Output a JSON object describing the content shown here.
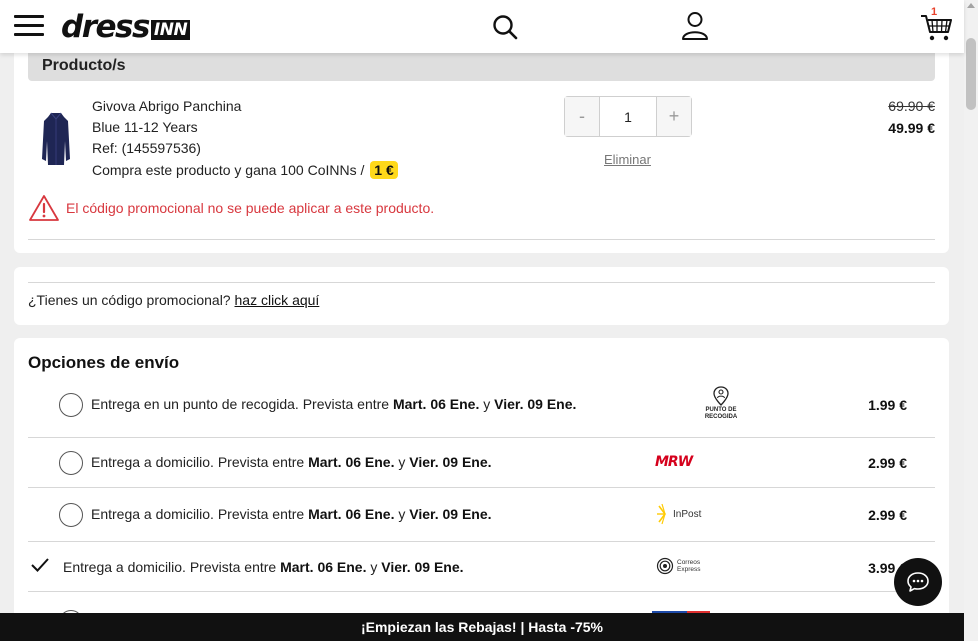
{
  "header": {
    "logo_main": "dress",
    "logo_badge": "INN",
    "cart_count": "1"
  },
  "products_section": {
    "title": "Producto/s",
    "item": {
      "name": "Givova Abrigo Panchina",
      "variant": "Blue 11-12 Years",
      "ref": "Ref: (145597536)",
      "coins_text": "Compra este producto y gana 100 CoINNs /",
      "coins_badge": "1 €",
      "quantity": "1",
      "qty_minus": "-",
      "qty_plus": "+",
      "remove_label": "Eliminar",
      "price_old": "69.90 €",
      "price_new": "49.99 €"
    },
    "promo_error": "El código promocional no se puede aplicar a este producto."
  },
  "promo": {
    "question": "¿Tienes un código promocional?",
    "link": "haz click aquí"
  },
  "shipping": {
    "title": "Opciones de envío",
    "options": [
      {
        "label": "Entrega en un punto de recogida. Prevista entre",
        "date_from": "Mart. 06 Ene.",
        "connector": "y",
        "date_to": "Vier. 09 Ene.",
        "carrier_line1": "PUNTO DE",
        "carrier_line2": "RECOGIDA",
        "price": "1.99 €",
        "selected": false
      },
      {
        "label": "Entrega a domicilio. Prevista entre",
        "date_from": "Mart. 06 Ene.",
        "connector": "y",
        "date_to": "Vier. 09 Ene.",
        "carrier": "MRW",
        "price": "2.99 €",
        "selected": false
      },
      {
        "label": "Entrega a domicilio. Prevista entre",
        "date_from": "Mart. 06 Ene.",
        "connector": "y",
        "date_to": "Vier. 09 Ene.",
        "carrier": "InPost",
        "price": "2.99 €",
        "selected": false
      },
      {
        "label": "Entrega a domicilio. Prevista entre",
        "date_from": "Mart. 06 Ene.",
        "connector": "y",
        "date_to": "Vier. 09 Ene.",
        "carrier_line1": "Correos",
        "carrier_line2": "Express",
        "price": "3.99 €",
        "selected": true
      }
    ]
  },
  "banner": {
    "text": "¡Empiezan las Rebajas! | Hasta -75%"
  },
  "colors": {
    "accent_yellow": "#ffd91a",
    "error_red": "#d8383f",
    "mrw_red": "#d5001c",
    "inpost_yellow": "#ffcb05"
  }
}
